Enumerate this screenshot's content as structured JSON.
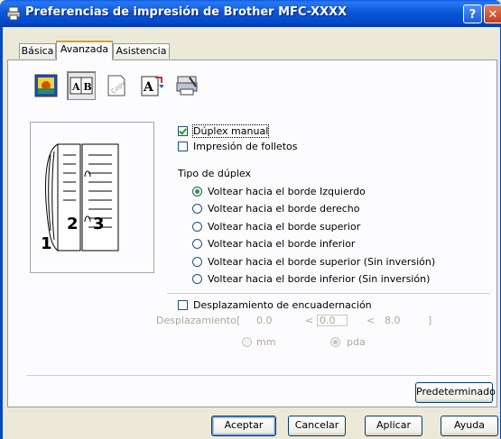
{
  "window": {
    "title": "Preferencias de impresión de Brother MFC-XXXX",
    "help_label": "?",
    "close_label": "✕"
  },
  "tabs": [
    {
      "label": "Básica",
      "active": false
    },
    {
      "label": "Avanzada",
      "active": true
    },
    {
      "label": "Asistencia",
      "active": false
    }
  ],
  "toolbar_icons": [
    {
      "name": "color-icon",
      "selected": false
    },
    {
      "name": "duplex-icon",
      "label": "A B",
      "selected": true
    },
    {
      "name": "watermark-icon",
      "label": "Copy",
      "selected": false
    },
    {
      "name": "page-setting-icon",
      "label": "A",
      "selected": false
    },
    {
      "name": "device-options-icon",
      "selected": false
    }
  ],
  "preview": {
    "page_numbers": [
      "1",
      "2",
      "3"
    ]
  },
  "options": {
    "duplex_manual": {
      "label": "Dúplex manual",
      "checked": true
    },
    "booklet": {
      "label": "Impresión de folletos",
      "checked": false
    }
  },
  "duplex_type": {
    "heading": "Tipo de dúplex",
    "choices": [
      {
        "label": "Voltear hacia el borde Izquierdo",
        "selected": true
      },
      {
        "label": "Voltear hacia el borde derecho",
        "selected": false
      },
      {
        "label": "Voltear hacia el borde superior",
        "selected": false
      },
      {
        "label": "Voltear hacia el borde inferior",
        "selected": false
      },
      {
        "label": "Voltear hacia el borde superior (Sin inversión)",
        "selected": false
      },
      {
        "label": "Voltear hacia el borde inferior (Sin inversión)",
        "selected": false
      }
    ]
  },
  "binding": {
    "label": "Desplazamiento de encuadernación",
    "checked": false,
    "offset_label": "Desplazamiento",
    "bracket_open": "[",
    "min": "0.0",
    "lt1": "<",
    "value": "0.0",
    "lt2": "<",
    "max": "8.0",
    "bracket_close": "]",
    "unit_mm": "mm",
    "unit_pda": "pda",
    "unit_selected": "pda"
  },
  "buttons": {
    "default": "Predeterminado",
    "accept": "Aceptar",
    "cancel": "Cancelar",
    "apply": "Aplicar",
    "help": "Ayuda"
  },
  "colors": {
    "title_bar": "#0b57d8",
    "dialog_bg": "#ece9d8",
    "panel_bg": "#fcfcfe",
    "check_green": "#21a121",
    "tab_highlight": "#e69b14"
  }
}
